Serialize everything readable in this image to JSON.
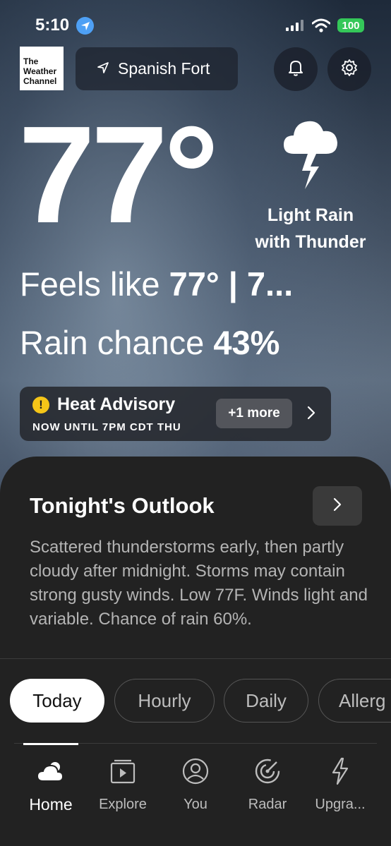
{
  "status_bar": {
    "time": "5:10",
    "battery": "100"
  },
  "header": {
    "logo_lines": [
      "The",
      "Weather",
      "Channel"
    ],
    "location": "Spanish Fort"
  },
  "current": {
    "temperature": "77°",
    "condition_line1": "Light Rain",
    "condition_line2": "with Thunder",
    "feels_prefix": "Feels like ",
    "feels_value": "77°",
    "feels_suffix": "  |  7...",
    "rain_prefix": "Rain chance ",
    "rain_value": "43%"
  },
  "advisory": {
    "icon": "!",
    "title": "Heat Advisory",
    "subtitle": "NOW UNTIL 7PM CDT THU",
    "more": "+1 more"
  },
  "outlook": {
    "title": "Tonight's Outlook",
    "text": "Scattered thunderstorms early, then partly cloudy after midnight. Storms may contain strong gusty winds. Low 77F. Winds light and variable. Chance of rain 60%."
  },
  "tabs": [
    {
      "label": "Today",
      "active": true
    },
    {
      "label": "Hourly"
    },
    {
      "label": "Daily"
    },
    {
      "label": "Allerg"
    }
  ],
  "nav": [
    {
      "label": "Home",
      "icon": "home-cloud-icon",
      "active": true
    },
    {
      "label": "Explore",
      "icon": "explore-video-icon"
    },
    {
      "label": "You",
      "icon": "profile-icon"
    },
    {
      "label": "Radar",
      "icon": "radar-icon"
    },
    {
      "label": "Upgra...",
      "icon": "lightning-icon"
    }
  ],
  "colors": {
    "battery": "#34c759",
    "location_dot": "#4ea0f5",
    "advisory_icon": "#f5c518",
    "panel": "#222222"
  }
}
